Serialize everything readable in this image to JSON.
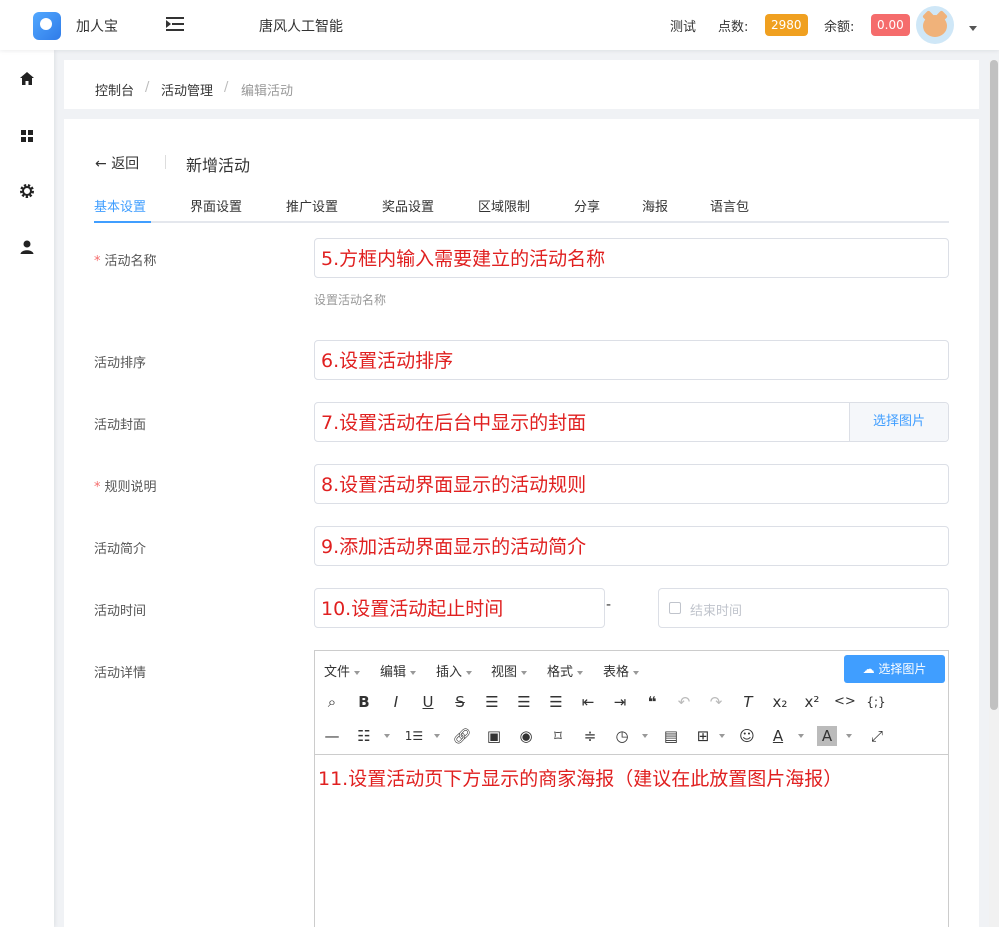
{
  "header": {
    "app_name": "加人宝",
    "site_name": "唐风人工智能",
    "user_name": "测试",
    "points_label": "点数:",
    "points_value": "2980",
    "balance_label": "余额:",
    "balance_value": "0.00",
    "colors": {
      "points_badge": "#f0a020",
      "balance_badge": "#f56c6c"
    }
  },
  "sidebar": {
    "icons": [
      "home-icon",
      "grid-icon",
      "gear-icon",
      "user-icon"
    ]
  },
  "breadcrumb": {
    "items": [
      "控制台",
      "活动管理",
      "编辑活动"
    ],
    "separator": "/"
  },
  "page": {
    "back_label": "返回",
    "title": "新增活动"
  },
  "tabs": [
    "基本设置",
    "界面设置",
    "推广设置",
    "奖品设置",
    "区域限制",
    "分享",
    "海报",
    "语言包"
  ],
  "active_tab": "基本设置",
  "form": {
    "name": {
      "label": "活动名称",
      "required": true,
      "value": "5.方框内输入需要建立的活动名称",
      "hint": "设置活动名称"
    },
    "sort": {
      "label": "活动排序",
      "value": "6.设置活动排序"
    },
    "cover": {
      "label": "活动封面",
      "value": "7.设置活动在后台中显示的封面",
      "button": "选择图片"
    },
    "rules": {
      "label": "规则说明",
      "required": true,
      "value": "8.设置活动界面显示的活动规则"
    },
    "intro": {
      "label": "活动简介",
      "value": "9.添加活动界面显示的活动简介"
    },
    "time": {
      "label": "活动时间",
      "start_value": "10.设置活动起止时间",
      "separator": "-",
      "end_placeholder": "结束时间"
    },
    "detail": {
      "label": "活动详情",
      "value": "11.设置活动页下方显示的商家海报（建议在此放置图片海报）"
    }
  },
  "editor": {
    "menus": [
      "文件",
      "编辑",
      "插入",
      "视图",
      "格式",
      "表格"
    ],
    "upload_button": "选择图片",
    "toolbar_row1": [
      "binoculars-icon",
      "bold-icon",
      "italic-icon",
      "underline-icon",
      "strikethrough-icon",
      "align-left-icon",
      "align-center-icon",
      "align-right-icon",
      "outdent-icon",
      "indent-icon",
      "blockquote-icon",
      "undo-icon",
      "redo-icon",
      "clear-format-icon",
      "subscript-icon",
      "superscript-icon",
      "code-icon",
      "code-sample-icon"
    ],
    "toolbar_row2": [
      "horizontal-rule-icon",
      "bullet-list-icon",
      "number-list-icon",
      "link-icon",
      "image-icon",
      "preview-icon",
      "bookmark-icon",
      "page-break-icon",
      "clock-icon",
      "media-icon",
      "table-icon",
      "emoji-icon",
      "text-color-icon",
      "background-color-icon",
      "fullscreen-icon"
    ]
  }
}
